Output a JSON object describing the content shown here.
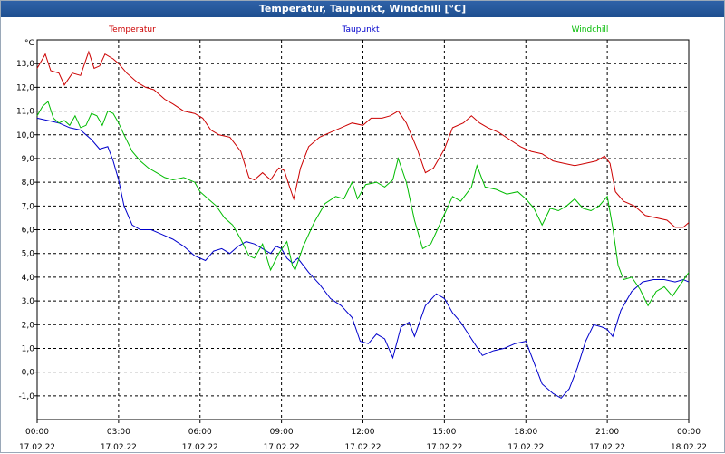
{
  "window": {
    "title": "Temperatur, Taupunkt, Windchill [°C]"
  },
  "chart_data": {
    "type": "line",
    "title": "Temperatur, Taupunkt, Windchill [°C]",
    "ylabel": "°C",
    "xlabel": "",
    "ylim": [
      -2,
      14
    ],
    "xlim": [
      0,
      24
    ],
    "grid": true,
    "legend_position": "top",
    "y_ticks": [
      "-1,0",
      "0,0",
      "1,0",
      "2,0",
      "3,0",
      "4,0",
      "5,0",
      "6,0",
      "7,0",
      "8,0",
      "9,0",
      "10,0",
      "11,0",
      "12,0",
      "13,0"
    ],
    "x_ticks": [
      {
        "time": "00:00",
        "date": "17.02.22"
      },
      {
        "time": "03:00",
        "date": "17.02.22"
      },
      {
        "time": "06:00",
        "date": "17.02.22"
      },
      {
        "time": "09:00",
        "date": "17.02.22"
      },
      {
        "time": "12:00",
        "date": "17.02.22"
      },
      {
        "time": "15:00",
        "date": "17.02.22"
      },
      {
        "time": "18:00",
        "date": "17.02.22"
      },
      {
        "time": "21:00",
        "date": "17.02.22"
      },
      {
        "time": "00:00",
        "date": "18.02.22"
      }
    ],
    "series": [
      {
        "name": "Temperatur",
        "color": "#cc0000",
        "points": [
          [
            0.0,
            12.8
          ],
          [
            0.3,
            13.4
          ],
          [
            0.5,
            12.7
          ],
          [
            0.8,
            12.6
          ],
          [
            1.0,
            12.1
          ],
          [
            1.3,
            12.6
          ],
          [
            1.6,
            12.5
          ],
          [
            1.9,
            13.5
          ],
          [
            2.1,
            12.8
          ],
          [
            2.3,
            12.9
          ],
          [
            2.5,
            13.4
          ],
          [
            2.8,
            13.2
          ],
          [
            3.0,
            13.0
          ],
          [
            3.3,
            12.6
          ],
          [
            3.7,
            12.2
          ],
          [
            4.0,
            12.0
          ],
          [
            4.3,
            11.9
          ],
          [
            4.7,
            11.5
          ],
          [
            5.0,
            11.3
          ],
          [
            5.4,
            11.0
          ],
          [
            5.8,
            10.9
          ],
          [
            6.1,
            10.7
          ],
          [
            6.4,
            10.2
          ],
          [
            6.7,
            10.0
          ],
          [
            7.1,
            9.9
          ],
          [
            7.5,
            9.3
          ],
          [
            7.8,
            8.2
          ],
          [
            8.0,
            8.1
          ],
          [
            8.3,
            8.4
          ],
          [
            8.6,
            8.1
          ],
          [
            8.9,
            8.6
          ],
          [
            9.1,
            8.5
          ],
          [
            9.3,
            7.8
          ],
          [
            9.45,
            7.3
          ],
          [
            9.7,
            8.6
          ],
          [
            10.0,
            9.5
          ],
          [
            10.4,
            9.9
          ],
          [
            10.8,
            10.1
          ],
          [
            11.2,
            10.3
          ],
          [
            11.6,
            10.5
          ],
          [
            12.0,
            10.4
          ],
          [
            12.3,
            10.7
          ],
          [
            12.7,
            10.7
          ],
          [
            13.0,
            10.8
          ],
          [
            13.3,
            11.0
          ],
          [
            13.6,
            10.5
          ],
          [
            14.0,
            9.4
          ],
          [
            14.3,
            8.4
          ],
          [
            14.6,
            8.6
          ],
          [
            15.0,
            9.4
          ],
          [
            15.3,
            10.3
          ],
          [
            15.7,
            10.5
          ],
          [
            16.0,
            10.8
          ],
          [
            16.3,
            10.5
          ],
          [
            16.6,
            10.3
          ],
          [
            17.0,
            10.1
          ],
          [
            17.4,
            9.8
          ],
          [
            17.8,
            9.5
          ],
          [
            18.2,
            9.3
          ],
          [
            18.6,
            9.2
          ],
          [
            19.0,
            8.9
          ],
          [
            19.4,
            8.8
          ],
          [
            19.8,
            8.7
          ],
          [
            20.2,
            8.8
          ],
          [
            20.6,
            8.9
          ],
          [
            20.9,
            9.1
          ],
          [
            21.1,
            8.8
          ],
          [
            21.3,
            7.6
          ],
          [
            21.6,
            7.2
          ],
          [
            22.0,
            7.0
          ],
          [
            22.4,
            6.6
          ],
          [
            22.8,
            6.5
          ],
          [
            23.2,
            6.4
          ],
          [
            23.5,
            6.1
          ],
          [
            23.8,
            6.1
          ],
          [
            24.0,
            6.3
          ]
        ]
      },
      {
        "name": "Taupunkt",
        "color": "#0000cc",
        "points": [
          [
            0.0,
            10.7
          ],
          [
            0.4,
            10.6
          ],
          [
            0.8,
            10.5
          ],
          [
            1.2,
            10.3
          ],
          [
            1.6,
            10.2
          ],
          [
            2.0,
            9.8
          ],
          [
            2.3,
            9.4
          ],
          [
            2.6,
            9.5
          ],
          [
            2.8,
            8.9
          ],
          [
            3.0,
            8.1
          ],
          [
            3.2,
            7.0
          ],
          [
            3.5,
            6.2
          ],
          [
            3.8,
            6.0
          ],
          [
            4.2,
            6.0
          ],
          [
            4.6,
            5.8
          ],
          [
            5.0,
            5.6
          ],
          [
            5.4,
            5.3
          ],
          [
            5.8,
            4.9
          ],
          [
            6.2,
            4.7
          ],
          [
            6.5,
            5.1
          ],
          [
            6.8,
            5.2
          ],
          [
            7.1,
            5.0
          ],
          [
            7.4,
            5.3
          ],
          [
            7.7,
            5.5
          ],
          [
            8.0,
            5.4
          ],
          [
            8.3,
            5.2
          ],
          [
            8.6,
            5.0
          ],
          [
            8.8,
            5.3
          ],
          [
            9.0,
            5.2
          ],
          [
            9.2,
            4.8
          ],
          [
            9.4,
            4.6
          ],
          [
            9.6,
            4.8
          ],
          [
            10.0,
            4.2
          ],
          [
            10.4,
            3.7
          ],
          [
            10.8,
            3.1
          ],
          [
            11.2,
            2.8
          ],
          [
            11.6,
            2.3
          ],
          [
            11.9,
            1.3
          ],
          [
            12.2,
            1.2
          ],
          [
            12.5,
            1.6
          ],
          [
            12.8,
            1.4
          ],
          [
            13.1,
            0.6
          ],
          [
            13.4,
            1.9
          ],
          [
            13.7,
            2.1
          ],
          [
            13.9,
            1.5
          ],
          [
            14.3,
            2.8
          ],
          [
            14.7,
            3.3
          ],
          [
            15.0,
            3.1
          ],
          [
            15.3,
            2.5
          ],
          [
            15.6,
            2.1
          ],
          [
            16.0,
            1.4
          ],
          [
            16.4,
            0.7
          ],
          [
            16.8,
            0.9
          ],
          [
            17.2,
            1.0
          ],
          [
            17.6,
            1.2
          ],
          [
            18.0,
            1.3
          ],
          [
            18.3,
            0.4
          ],
          [
            18.6,
            -0.5
          ],
          [
            19.0,
            -0.9
          ],
          [
            19.3,
            -1.1
          ],
          [
            19.6,
            -0.7
          ],
          [
            19.9,
            0.2
          ],
          [
            20.2,
            1.3
          ],
          [
            20.5,
            2.0
          ],
          [
            20.8,
            1.9
          ],
          [
            21.0,
            1.8
          ],
          [
            21.2,
            1.5
          ],
          [
            21.5,
            2.6
          ],
          [
            21.9,
            3.4
          ],
          [
            22.3,
            3.8
          ],
          [
            22.7,
            3.9
          ],
          [
            23.1,
            3.9
          ],
          [
            23.5,
            3.8
          ],
          [
            23.8,
            3.9
          ],
          [
            24.0,
            3.8
          ]
        ]
      },
      {
        "name": "Windchill",
        "color": "#00bb00",
        "points": [
          [
            0.0,
            10.8
          ],
          [
            0.2,
            11.2
          ],
          [
            0.4,
            11.4
          ],
          [
            0.6,
            10.7
          ],
          [
            0.8,
            10.5
          ],
          [
            1.0,
            10.6
          ],
          [
            1.2,
            10.4
          ],
          [
            1.4,
            10.8
          ],
          [
            1.6,
            10.3
          ],
          [
            1.8,
            10.4
          ],
          [
            2.0,
            10.9
          ],
          [
            2.2,
            10.8
          ],
          [
            2.4,
            10.4
          ],
          [
            2.6,
            11.0
          ],
          [
            2.8,
            10.9
          ],
          [
            3.0,
            10.5
          ],
          [
            3.2,
            10.0
          ],
          [
            3.5,
            9.3
          ],
          [
            3.8,
            8.9
          ],
          [
            4.1,
            8.6
          ],
          [
            4.4,
            8.4
          ],
          [
            4.7,
            8.2
          ],
          [
            5.0,
            8.1
          ],
          [
            5.4,
            8.2
          ],
          [
            5.8,
            8.0
          ],
          [
            6.0,
            7.6
          ],
          [
            6.3,
            7.3
          ],
          [
            6.6,
            7.0
          ],
          [
            6.9,
            6.5
          ],
          [
            7.2,
            6.2
          ],
          [
            7.5,
            5.6
          ],
          [
            7.8,
            4.9
          ],
          [
            8.0,
            4.8
          ],
          [
            8.3,
            5.4
          ],
          [
            8.6,
            4.3
          ],
          [
            8.9,
            5.0
          ],
          [
            9.2,
            5.5
          ],
          [
            9.4,
            4.5
          ],
          [
            9.5,
            4.3
          ],
          [
            9.8,
            5.3
          ],
          [
            10.2,
            6.3
          ],
          [
            10.6,
            7.1
          ],
          [
            11.0,
            7.4
          ],
          [
            11.3,
            7.3
          ],
          [
            11.6,
            8.0
          ],
          [
            11.8,
            7.3
          ],
          [
            12.1,
            7.9
          ],
          [
            12.5,
            8.0
          ],
          [
            12.8,
            7.8
          ],
          [
            13.1,
            8.1
          ],
          [
            13.3,
            9.0
          ],
          [
            13.6,
            8.0
          ],
          [
            13.9,
            6.4
          ],
          [
            14.2,
            5.2
          ],
          [
            14.5,
            5.4
          ],
          [
            14.9,
            6.4
          ],
          [
            15.3,
            7.4
          ],
          [
            15.6,
            7.2
          ],
          [
            16.0,
            7.8
          ],
          [
            16.2,
            8.7
          ],
          [
            16.5,
            7.8
          ],
          [
            16.9,
            7.7
          ],
          [
            17.3,
            7.5
          ],
          [
            17.7,
            7.6
          ],
          [
            18.0,
            7.3
          ],
          [
            18.3,
            6.9
          ],
          [
            18.6,
            6.2
          ],
          [
            18.9,
            6.9
          ],
          [
            19.2,
            6.8
          ],
          [
            19.5,
            7.0
          ],
          [
            19.8,
            7.3
          ],
          [
            20.1,
            6.9
          ],
          [
            20.4,
            6.8
          ],
          [
            20.7,
            7.0
          ],
          [
            21.0,
            7.4
          ],
          [
            21.2,
            6.1
          ],
          [
            21.4,
            4.5
          ],
          [
            21.6,
            3.9
          ],
          [
            21.9,
            4.0
          ],
          [
            22.2,
            3.5
          ],
          [
            22.5,
            2.8
          ],
          [
            22.8,
            3.4
          ],
          [
            23.1,
            3.6
          ],
          [
            23.4,
            3.2
          ],
          [
            23.7,
            3.7
          ],
          [
            24.0,
            4.2
          ]
        ]
      }
    ]
  }
}
